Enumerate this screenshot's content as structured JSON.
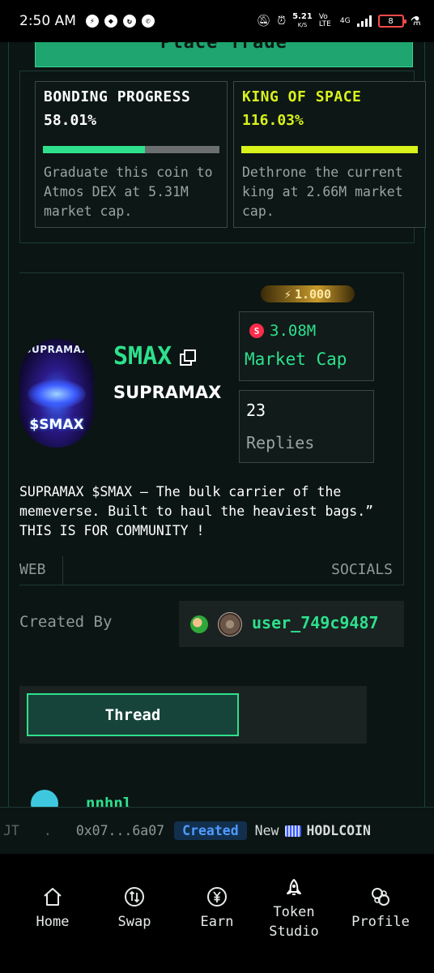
{
  "status_bar": {
    "time": "2:50 AM",
    "speed_value": "5.21",
    "speed_unit": "K/S",
    "volte": "Vo LTE",
    "network": "4G",
    "battery": "8"
  },
  "trade": {
    "button_label": "Place Trade"
  },
  "bonding": {
    "title": "BONDING PROGRESS",
    "percent": "58.01%",
    "progress": 0.5801,
    "description": "Graduate this coin to Atmos DEX at 5.31M market cap.",
    "accent": "#2ee08c"
  },
  "king": {
    "title": "KING OF SPACE",
    "percent": "116.03%",
    "progress": 1.0,
    "description": "Dethrone the current king at 2.66M market cap.",
    "accent": "#d9f21a"
  },
  "token": {
    "boost": "1.000",
    "image_text_top": "SUPRAMAX",
    "image_text_bottom": "$SMAX",
    "ticker": "SMAX",
    "name": "SUPRAMAX",
    "market_cap_value": "3.08M",
    "market_cap_label": "Market Cap",
    "replies_value": "23",
    "replies_label": "Replies",
    "description": "SUPRAMAX $SMAX – The bulk carrier of the memeverse. Built to haul the heaviest bags.” THIS IS FOR COMMUNITY !"
  },
  "links": {
    "web": "WEB",
    "socials": "SOCIALS"
  },
  "creator": {
    "label": "Created By",
    "username": "user_749c9487"
  },
  "tabs": {
    "thread": "Thread"
  },
  "next_comment": {
    "author": "nnhnl"
  },
  "tape": {
    "left_fragment": "JT",
    "dot": ".",
    "address": "0x07...6a07",
    "badge": "Created",
    "new": "New",
    "coin": "HODLCOIN"
  },
  "nav": {
    "home": "Home",
    "swap": "Swap",
    "earn": "Earn",
    "studio_line1": "Token",
    "studio_line2": "Studio",
    "profile": "Profile"
  },
  "colors": {
    "accent_green": "#2ee08c",
    "accent_yellow": "#d9f21a",
    "background": "#0b1514"
  }
}
